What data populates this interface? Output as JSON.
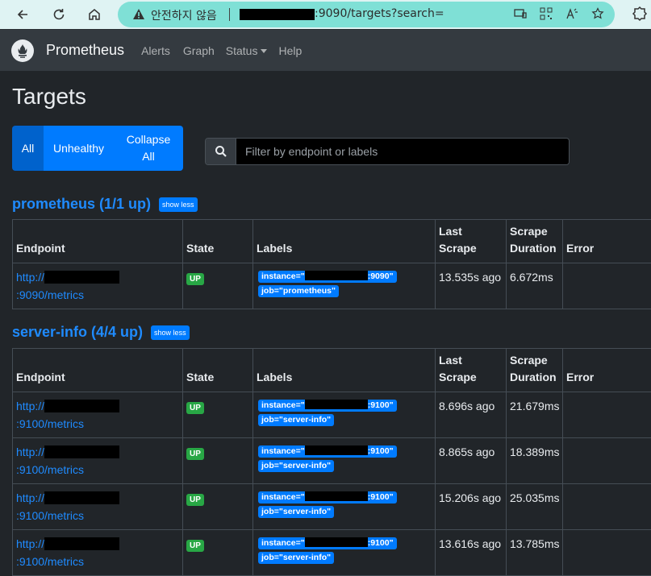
{
  "browser": {
    "insecure_label": "안전하지 않음",
    "url_suffix": ":9090/targets?search="
  },
  "navbar": {
    "brand": "Prometheus",
    "links": [
      "Alerts",
      "Graph",
      "Status",
      "Help"
    ]
  },
  "page": {
    "title": "Targets",
    "filters": [
      "All",
      "Unhealthy",
      "Collapse All"
    ],
    "search_placeholder": "Filter by endpoint or labels",
    "columns": [
      "Endpoint",
      "State",
      "Labels",
      "Last Scrape",
      "Scrape Duration",
      "Error"
    ]
  },
  "jobs": [
    {
      "title": "prometheus (1/1 up)",
      "toggle": "show less",
      "rows": [
        {
          "ep_pre": "http://",
          "ep_post": ":9090/metrics",
          "state": "UP",
          "inst_pre": "instance=\"",
          "inst_post": ":9090\"",
          "job_label": "job=\"prometheus\"",
          "last": "13.535s ago",
          "duration": "6.672ms",
          "error": ""
        }
      ]
    },
    {
      "title": "server-info (4/4 up)",
      "toggle": "show less",
      "rows": [
        {
          "ep_pre": "http://",
          "ep_post": ":9100/metrics",
          "state": "UP",
          "inst_pre": "instance=\"",
          "inst_post": ":9100\"",
          "job_label": "job=\"server-info\"",
          "last": "8.696s ago",
          "duration": "21.679ms",
          "error": ""
        },
        {
          "ep_pre": "http://",
          "ep_post": ":9100/metrics",
          "state": "UP",
          "inst_pre": "instance=\"",
          "inst_post": ":9100\"",
          "job_label": "job=\"server-info\"",
          "last": "8.865s ago",
          "duration": "18.389ms",
          "error": ""
        },
        {
          "ep_pre": "http://",
          "ep_post": ":9100/metrics",
          "state": "UP",
          "inst_pre": "instance=\"",
          "inst_post": ":9100\"",
          "job_label": "job=\"server-info\"",
          "last": "15.206s ago",
          "duration": "25.035ms",
          "error": ""
        },
        {
          "ep_pre": "http://",
          "ep_post": ":9100/metrics",
          "state": "UP",
          "inst_pre": "instance=\"",
          "inst_post": ":9100\"",
          "job_label": "job=\"server-info\"",
          "last": "13.616s ago",
          "duration": "13.785ms",
          "error": ""
        }
      ]
    }
  ]
}
